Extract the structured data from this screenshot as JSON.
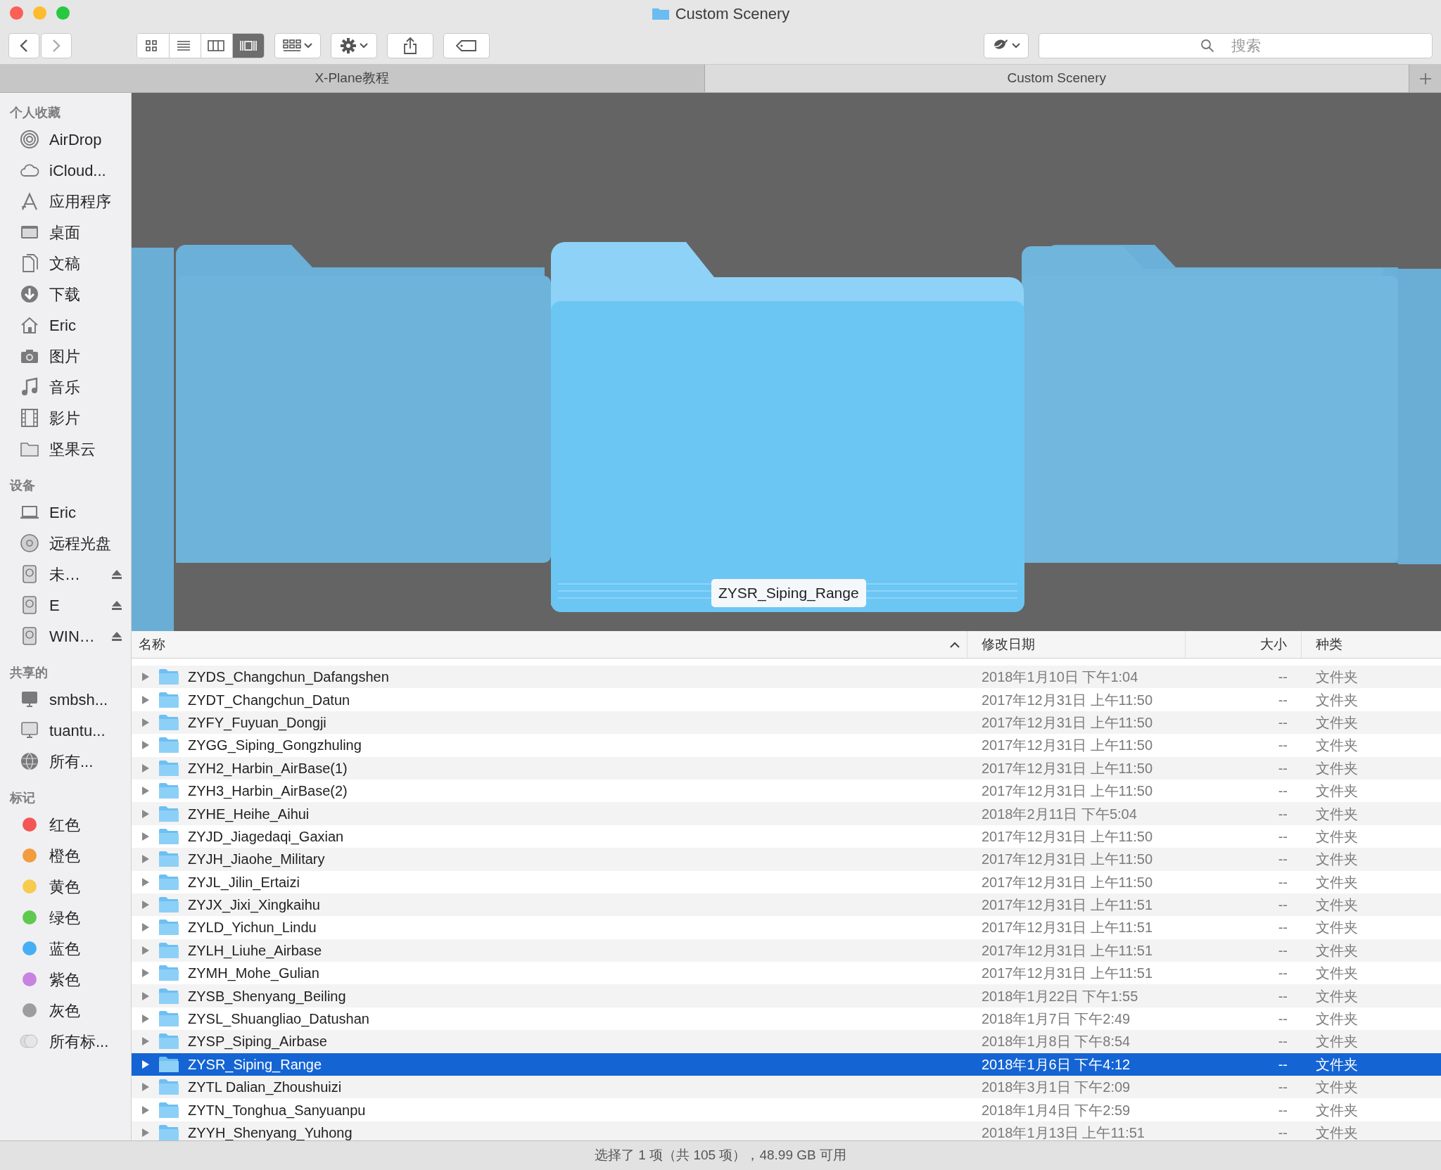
{
  "window": {
    "title": "Custom Scenery"
  },
  "toolbar": {
    "view_modes": [
      {
        "selected": false
      },
      {
        "selected": false
      },
      {
        "selected": false
      },
      {
        "selected": true
      }
    ],
    "search": {
      "placeholder": "搜索"
    }
  },
  "tabs": [
    {
      "label": "X-Plane教程",
      "selected": false
    },
    {
      "label": "Custom Scenery",
      "selected": true
    }
  ],
  "sidebar": [
    {
      "heading": "个人收藏",
      "items": [
        {
          "label": "AirDrop"
        },
        {
          "label": "iCloud..."
        },
        {
          "label": "应用程序"
        },
        {
          "label": "桌面"
        },
        {
          "label": "文稿"
        },
        {
          "label": "下载"
        },
        {
          "label": "Eric"
        },
        {
          "label": "图片"
        },
        {
          "label": "音乐"
        },
        {
          "label": "影片"
        },
        {
          "label": "坚果云"
        }
      ]
    },
    {
      "heading": "设备",
      "items": [
        {
          "label": "Eric",
          "eject": false
        },
        {
          "label": "远程光盘",
          "eject": false
        },
        {
          "label": "未…",
          "eject": true
        },
        {
          "label": "E",
          "eject": true
        },
        {
          "label": "WIN…",
          "eject": true
        }
      ]
    },
    {
      "heading": "共享的",
      "items": [
        {
          "label": "smbsh..."
        },
        {
          "label": "tuantu..."
        },
        {
          "label": "所有..."
        }
      ]
    },
    {
      "heading": "标记",
      "items": [
        {
          "label": "红色",
          "color": "#f25756"
        },
        {
          "label": "橙色",
          "color": "#f39c3d"
        },
        {
          "label": "黄色",
          "color": "#f7cb4d"
        },
        {
          "label": "绿色",
          "color": "#5fc94f"
        },
        {
          "label": "蓝色",
          "color": "#47aef5"
        },
        {
          "label": "紫色",
          "color": "#c883e0"
        },
        {
          "label": "灰色",
          "color": "#9d9d9f"
        },
        {
          "label": "所有标..."
        }
      ]
    }
  ],
  "cover_flow": {
    "caption": "ZYSR_Siping_Range"
  },
  "table": {
    "columns": [
      "名称",
      "修改日期",
      "大小",
      "种类"
    ],
    "rows": [
      {
        "name": "ZYDS_Changchun_Dafangshen",
        "date": "2018年1月10日 下午1:04",
        "size": "--",
        "kind": "文件夹",
        "selected": false
      },
      {
        "name": "ZYDT_Changchun_Datun",
        "date": "2017年12月31日 上午11:50",
        "size": "--",
        "kind": "文件夹",
        "selected": false
      },
      {
        "name": "ZYFY_Fuyuan_Dongji",
        "date": "2017年12月31日 上午11:50",
        "size": "--",
        "kind": "文件夹",
        "selected": false
      },
      {
        "name": "ZYGG_Siping_Gongzhuling",
        "date": "2017年12月31日 上午11:50",
        "size": "--",
        "kind": "文件夹",
        "selected": false
      },
      {
        "name": "ZYH2_Harbin_AirBase(1)",
        "date": "2017年12月31日 上午11:50",
        "size": "--",
        "kind": "文件夹",
        "selected": false
      },
      {
        "name": "ZYH3_Harbin_AirBase(2)",
        "date": "2017年12月31日 上午11:50",
        "size": "--",
        "kind": "文件夹",
        "selected": false
      },
      {
        "name": "ZYHE_Heihe_Aihui",
        "date": "2018年2月11日 下午5:04",
        "size": "--",
        "kind": "文件夹",
        "selected": false
      },
      {
        "name": "ZYJD_Jiagedaqi_Gaxian",
        "date": "2017年12月31日 上午11:50",
        "size": "--",
        "kind": "文件夹",
        "selected": false
      },
      {
        "name": "ZYJH_Jiaohe_Military",
        "date": "2017年12月31日 上午11:50",
        "size": "--",
        "kind": "文件夹",
        "selected": false
      },
      {
        "name": "ZYJL_Jilin_Ertaizi",
        "date": "2017年12月31日 上午11:50",
        "size": "--",
        "kind": "文件夹",
        "selected": false
      },
      {
        "name": "ZYJX_Jixi_Xingkaihu",
        "date": "2017年12月31日 上午11:51",
        "size": "--",
        "kind": "文件夹",
        "selected": false
      },
      {
        "name": "ZYLD_Yichun_Lindu",
        "date": "2017年12月31日 上午11:51",
        "size": "--",
        "kind": "文件夹",
        "selected": false
      },
      {
        "name": "ZYLH_Liuhe_Airbase",
        "date": "2017年12月31日 上午11:51",
        "size": "--",
        "kind": "文件夹",
        "selected": false
      },
      {
        "name": "ZYMH_Mohe_Gulian",
        "date": "2017年12月31日 上午11:51",
        "size": "--",
        "kind": "文件夹",
        "selected": false
      },
      {
        "name": "ZYSB_Shenyang_Beiling",
        "date": "2018年1月22日 下午1:55",
        "size": "--",
        "kind": "文件夹",
        "selected": false
      },
      {
        "name": "ZYSL_Shuangliao_Datushan",
        "date": "2018年1月7日 下午2:49",
        "size": "--",
        "kind": "文件夹",
        "selected": false
      },
      {
        "name": "ZYSP_Siping_Airbase",
        "date": "2018年1月8日 下午8:54",
        "size": "--",
        "kind": "文件夹",
        "selected": false
      },
      {
        "name": "ZYSR_Siping_Range",
        "date": "2018年1月6日 下午4:12",
        "size": "--",
        "kind": "文件夹",
        "selected": true
      },
      {
        "name": "ZYTL Dalian_Zhoushuizi",
        "date": "2018年3月1日 下午2:09",
        "size": "--",
        "kind": "文件夹",
        "selected": false
      },
      {
        "name": "ZYTN_Tonghua_Sanyuanpu",
        "date": "2018年1月4日 下午2:59",
        "size": "--",
        "kind": "文件夹",
        "selected": false
      },
      {
        "name": "ZYYH_Shenyang_Yuhong",
        "date": "2018年1月13日 上午11:51",
        "size": "--",
        "kind": "文件夹",
        "selected": false
      }
    ]
  },
  "status_bar": "选择了 1 项（共 105 项），48.99 GB 可用"
}
